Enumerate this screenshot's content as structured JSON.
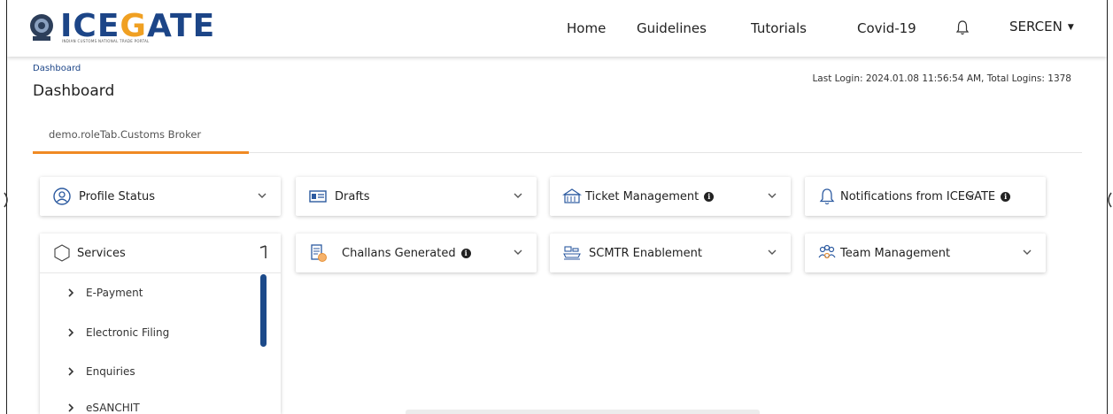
{
  "header": {
    "logo_text_a": "ICE",
    "logo_text_b": "G",
    "logo_text_c": "ATE",
    "logo_subtitle": "INDIAN CUSTOMS NATIONAL TRADE PORTAL",
    "nav": [
      "Home",
      "Guidelines",
      "Tutorials",
      "Covid-19"
    ],
    "user": "SERCEN"
  },
  "page": {
    "breadcrumb": "Dashboard",
    "title": "Dashboard",
    "last_login": "Last Login: 2024.01.08 11:56:54 AM, Total Logins: 1378",
    "tab": "demo.roleTab.Customs Broker"
  },
  "cards": {
    "profile": "Profile Status",
    "drafts": "Drafts",
    "ticket": "Ticket Management",
    "notifications": "Notifications from ICEGATE",
    "challans": "Challans Generated",
    "scmtr": "SCMTR Enablement",
    "team": "Team Management",
    "info_glyph": "i"
  },
  "services": {
    "title": "Services",
    "items": [
      "E-Payment",
      "Electronic Filing",
      "Enquiries",
      "eSANCHIT"
    ]
  },
  "colors": {
    "brand_blue": "#1c4587",
    "accent_orange": "#f08a24"
  }
}
